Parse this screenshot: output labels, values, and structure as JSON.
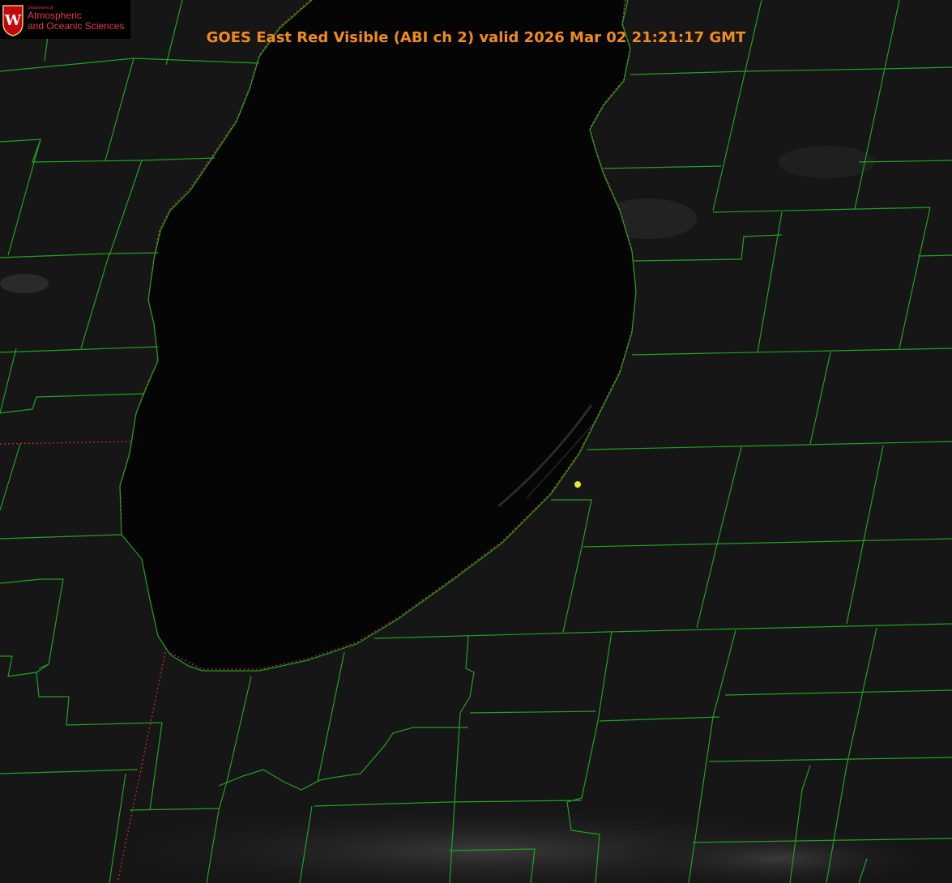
{
  "title": "GOES East Red Visible (ABI ch 2) valid 2026 Mar 02 21:21:17 GMT",
  "logo": {
    "department_line": "Department of",
    "line1": "Atmospheric",
    "line2": "and Oceanic Sciences",
    "seal_letter": "W"
  },
  "colors": {
    "county_lines": "#1fa31f",
    "state_lines": "#d0302a",
    "title": "#f08c1e",
    "marker": "#e6e62a",
    "lake": "#050505",
    "land": "#141414"
  },
  "icons": [
    "uw-seal-icon",
    "location-marker-icon"
  ]
}
